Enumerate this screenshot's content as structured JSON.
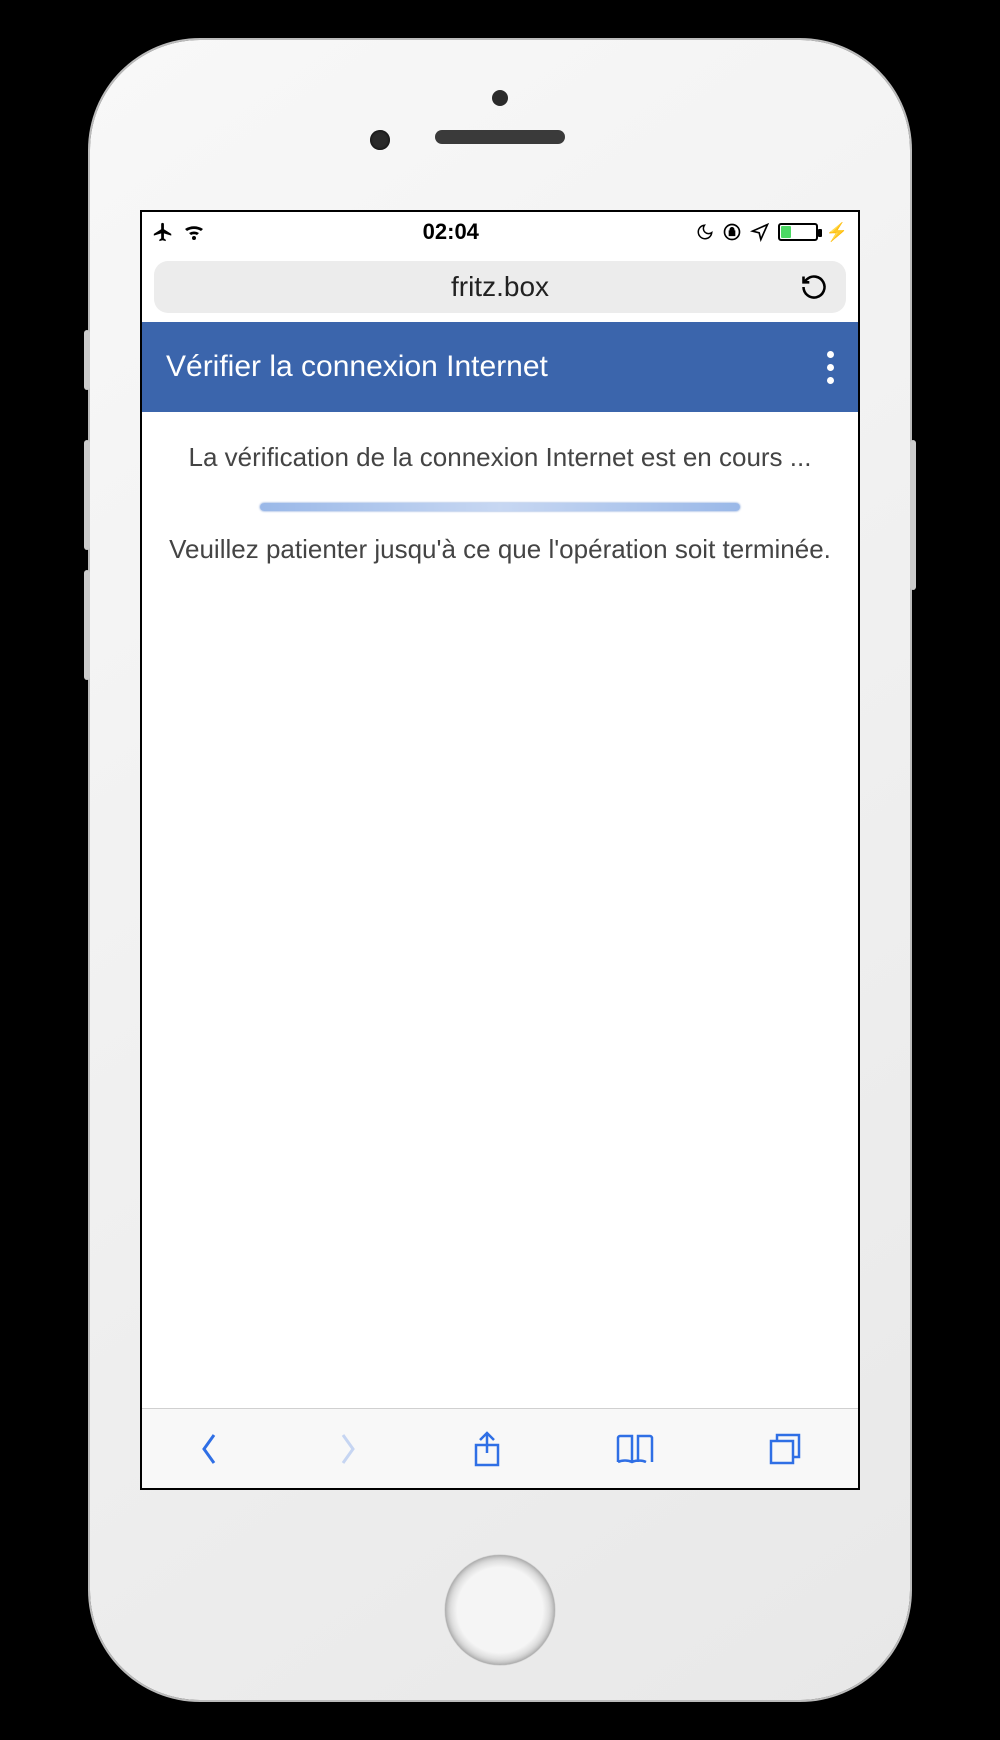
{
  "statusbar": {
    "time": "02:04"
  },
  "browser": {
    "domain": "fritz.box"
  },
  "page": {
    "header_title": "Vérifier la connexion Internet",
    "status_text": "La vérification de la connexion Internet est en cours ...",
    "wait_text": "Veuillez patienter jusqu'à ce que l'opération soit terminée."
  }
}
